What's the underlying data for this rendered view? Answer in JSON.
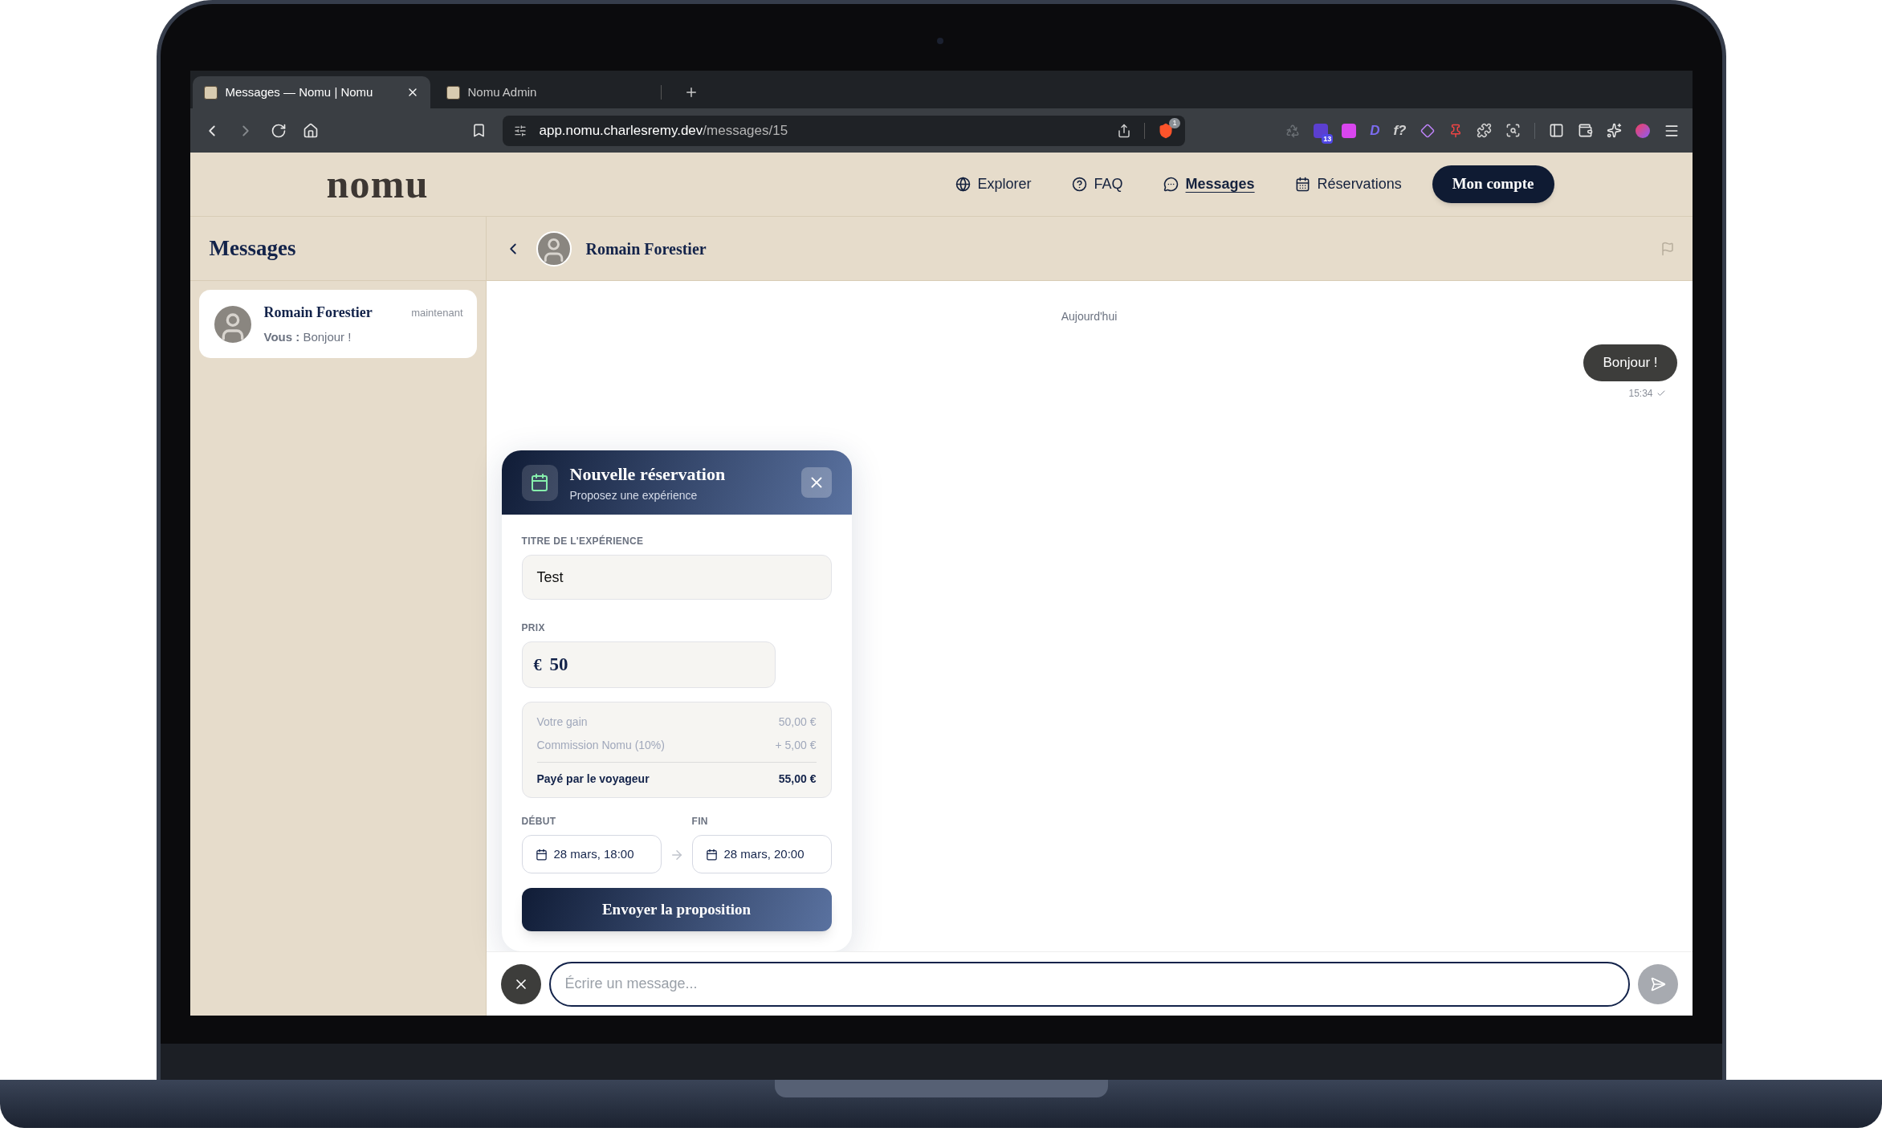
{
  "browser": {
    "tabs": [
      {
        "title": "Messages — Nomu | Nomu",
        "selected": true
      },
      {
        "title": "Nomu Admin",
        "selected": false
      }
    ],
    "address": {
      "host": "app.nomu.charlesremy.dev",
      "path": "/messages/15"
    },
    "shield_badge": "1",
    "extensions": [
      {
        "kind": "recycle"
      },
      {
        "kind": "badge",
        "badge": "13"
      },
      {
        "kind": "pink"
      },
      {
        "kind": "glyph",
        "text": "D"
      },
      {
        "kind": "glyph",
        "text": "f?"
      },
      {
        "kind": "diamond"
      },
      {
        "kind": "pin"
      },
      {
        "kind": "puzzle"
      },
      {
        "kind": "search"
      },
      {
        "kind": "separator"
      },
      {
        "kind": "sidebar"
      },
      {
        "kind": "wallet"
      },
      {
        "kind": "sparkle"
      },
      {
        "kind": "orb"
      },
      {
        "kind": "menu"
      }
    ]
  },
  "app": {
    "logo": "nomu",
    "nav": [
      {
        "label": "Explorer",
        "selected": false
      },
      {
        "label": "FAQ",
        "selected": false
      },
      {
        "label": "Messages",
        "selected": true
      },
      {
        "label": "Réservations",
        "selected": false
      }
    ],
    "account_button": "Mon compte"
  },
  "sidebar": {
    "title": "Messages",
    "conversations": [
      {
        "name": "Romain Forestier",
        "time": "maintenant",
        "preview": "**Vous :** Bonjour !",
        "selected": true
      }
    ]
  },
  "chat": {
    "contact": "Romain Forestier",
    "day": "Aujourd'hui",
    "messages": [
      {
        "text": "Bonjour !",
        "time": "15:34",
        "read": true
      }
    ]
  },
  "proposal": {
    "title": "Nouvelle réservation",
    "subtitle": "Proposez une expérience",
    "title_label": "TITRE DE L'EXPÉRIENCE",
    "title_value": "Test",
    "price_label": "PRIX",
    "currency": "€",
    "price_value": "50",
    "summary": [
      {
        "label": "Votre gain",
        "value": "50,00 €",
        "total": false
      },
      {
        "label": "Commission Nomu (10%)",
        "value": "+ 5,00 €",
        "total": false
      },
      {
        "label": "Payé par le voyageur",
        "value": "55,00 €",
        "total": true
      }
    ],
    "start_label": "DÉBUT",
    "start_value": "28 mars, 18:00",
    "end_label": "FIN",
    "end_value": "28 mars, 20:00",
    "submit": "Envoyer la proposition"
  },
  "composer": {
    "placeholder": "Écrire un message..."
  }
}
